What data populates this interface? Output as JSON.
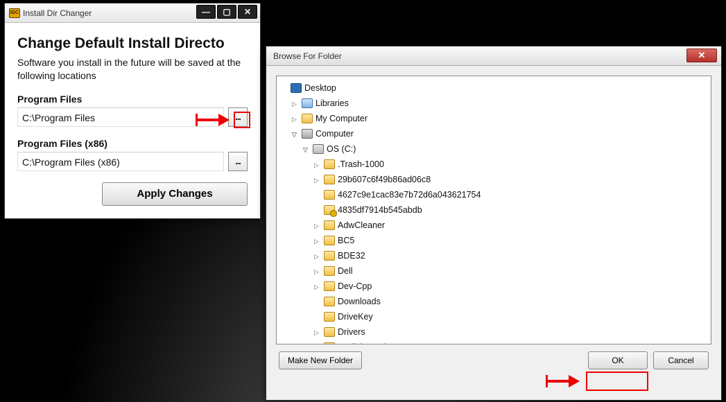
{
  "win1": {
    "app_icon_text": "IDC",
    "title": "Install Dir Changer",
    "heading": "Change Default Install Directo",
    "subtext": "Software you install in the future will be saved at the following locations",
    "pf": {
      "label": "Program Files",
      "value": "C:\\Program Files",
      "browse": "..."
    },
    "pf86": {
      "label": "Program Files (x86)",
      "value": "C:\\Program Files (x86)",
      "browse": "..."
    },
    "apply": "Apply Changes",
    "minimize": "—",
    "maximize": "▢",
    "close": "✕"
  },
  "win2": {
    "title": "Browse For Folder",
    "close": "✕",
    "make_new": "Make New Folder",
    "ok": "OK",
    "cancel": "Cancel",
    "tree": [
      {
        "depth": 0,
        "twisty": "none",
        "icon": "desktop",
        "label": "Desktop"
      },
      {
        "depth": 1,
        "twisty": "closed",
        "icon": "library",
        "label": "Libraries"
      },
      {
        "depth": 1,
        "twisty": "closed",
        "icon": "folder",
        "label": "My Computer"
      },
      {
        "depth": 1,
        "twisty": "open",
        "icon": "computer",
        "label": "Computer"
      },
      {
        "depth": 2,
        "twisty": "open",
        "icon": "drive",
        "label": "OS (C:)"
      },
      {
        "depth": 3,
        "twisty": "closed",
        "icon": "folder",
        "label": ".Trash-1000"
      },
      {
        "depth": 3,
        "twisty": "closed",
        "icon": "folder",
        "label": "29b607c6f49b86ad06c8"
      },
      {
        "depth": 3,
        "twisty": "none",
        "icon": "folder",
        "label": "4627c9e1cac83e7b72d6a043621754"
      },
      {
        "depth": 3,
        "twisty": "none",
        "icon": "locked",
        "label": "4835df7914b545abdb"
      },
      {
        "depth": 3,
        "twisty": "closed",
        "icon": "folder",
        "label": "AdwCleaner"
      },
      {
        "depth": 3,
        "twisty": "closed",
        "icon": "folder",
        "label": "BC5"
      },
      {
        "depth": 3,
        "twisty": "closed",
        "icon": "folder",
        "label": "BDE32"
      },
      {
        "depth": 3,
        "twisty": "closed",
        "icon": "folder",
        "label": "Dell"
      },
      {
        "depth": 3,
        "twisty": "closed",
        "icon": "folder",
        "label": "Dev-Cpp"
      },
      {
        "depth": 3,
        "twisty": "none",
        "icon": "folder",
        "label": "Downloads"
      },
      {
        "depth": 3,
        "twisty": "none",
        "icon": "folder",
        "label": "DriveKey"
      },
      {
        "depth": 3,
        "twisty": "closed",
        "icon": "folder",
        "label": "Drivers"
      },
      {
        "depth": 3,
        "twisty": "closed",
        "icon": "folder",
        "label": "english movies"
      }
    ]
  }
}
